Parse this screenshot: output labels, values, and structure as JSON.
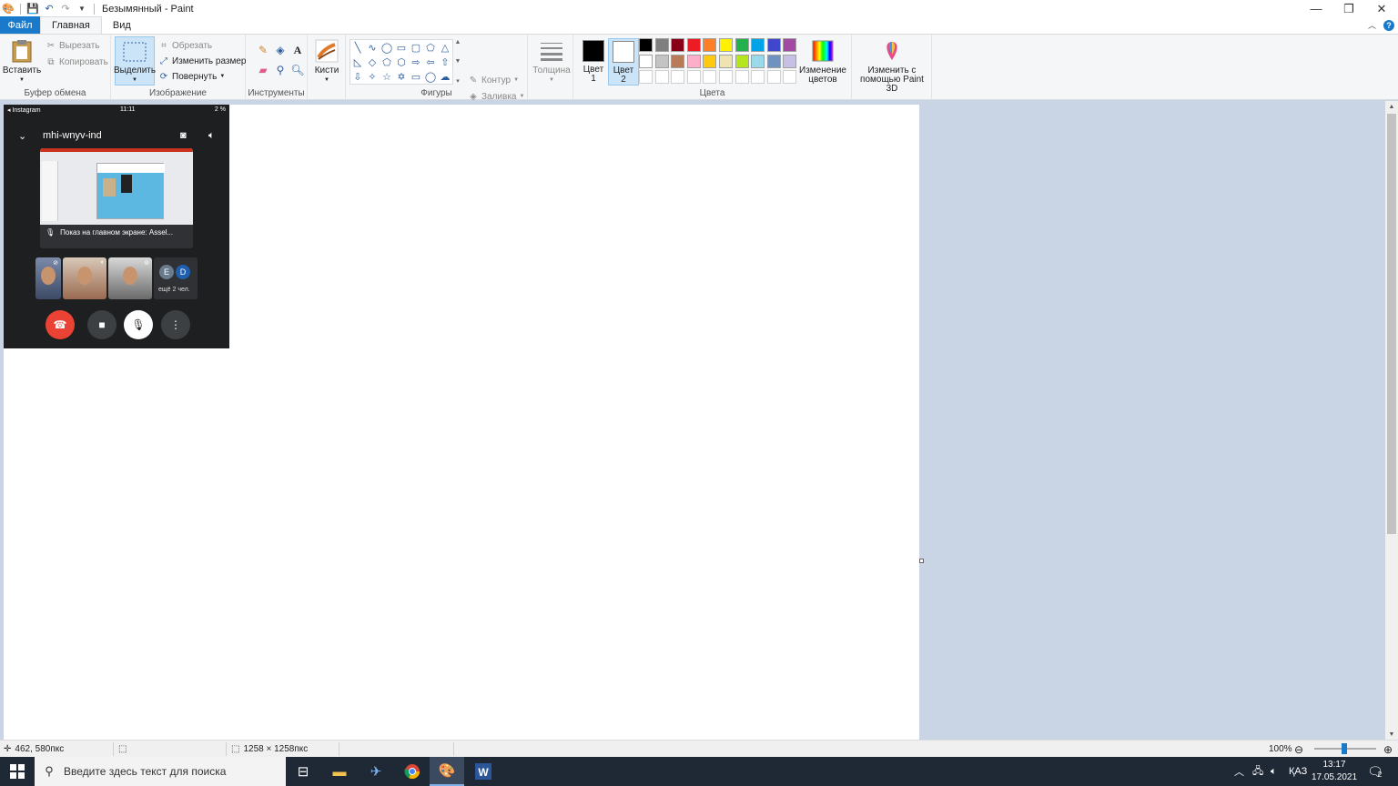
{
  "window": {
    "title": "Безымянный - Paint"
  },
  "tabs": {
    "file": "Файл",
    "home": "Главная",
    "view": "Вид"
  },
  "clipboard": {
    "paste": "Вставить",
    "cut": "Вырезать",
    "copy": "Копировать",
    "group_label": "Буфер обмена"
  },
  "image": {
    "select": "Выделить",
    "crop": "Обрезать",
    "resize": "Изменить размер",
    "rotate": "Повернуть",
    "group_label": "Изображение"
  },
  "tools": {
    "group_label": "Инструменты"
  },
  "brushes": {
    "label": "Кисти"
  },
  "shapes": {
    "outline": "Контур",
    "fill": "Заливка",
    "group_label": "Фигуры"
  },
  "size": {
    "label": "Толщина"
  },
  "colors": {
    "color1_line1": "Цвет",
    "color1_line2": "1",
    "color2_line1": "Цвет",
    "color2_line2": "2",
    "edit_line1": "Изменение",
    "edit_line2": "цветов",
    "paint3d_line1": "Изменить с",
    "paint3d_line2": "помощью Paint 3D",
    "group_label": "Цвета",
    "palette_row1": [
      "#000000",
      "#7f7f7f",
      "#880015",
      "#ed1c24",
      "#ff7f27",
      "#fff200",
      "#22b14c",
      "#00a2e8",
      "#3f48cc",
      "#a349a4"
    ],
    "palette_row2": [
      "#ffffff",
      "#c3c3c3",
      "#b97a57",
      "#ffaec9",
      "#ffc90e",
      "#efe4b0",
      "#b5e61d",
      "#99d9ea",
      "#7092be",
      "#c8bfe7"
    ],
    "color1": "#000000",
    "color2": "#ffffff"
  },
  "phone": {
    "status_left": "◂ Instagram",
    "status_time": "11:11",
    "status_right": "2 %",
    "meeting_code": "mhi-wnyv-ind",
    "share_caption": "Показ на главном экране: Assel...",
    "avatar_e": "E",
    "avatar_d": "D",
    "more_people": "ещё 2 чел."
  },
  "statusbar": {
    "cursor_pos": "462, 580пкс",
    "image_size": "1258 × 1258пкс",
    "zoom": "100%",
    "zoom_level_percent": 100
  },
  "taskbar": {
    "search_placeholder": "Введите здесь текст для поиска",
    "lang": "ҚАЗ",
    "time": "13:17",
    "date": "17.05.2021",
    "notif_count": "2"
  }
}
